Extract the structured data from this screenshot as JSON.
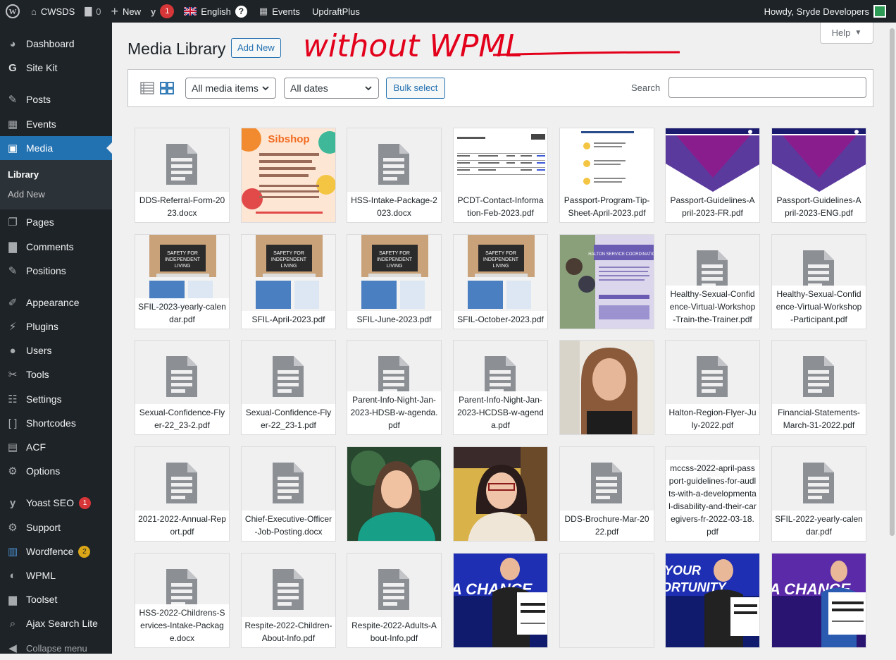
{
  "adminbar": {
    "site_name": "CWSDS",
    "comments_count": "0",
    "new_label": "New",
    "yoast_count": "1",
    "language": "English",
    "events": "Events",
    "updraft": "UpdraftPlus",
    "howdy": "Howdy, Sryde Developers"
  },
  "sidebar": {
    "dashboard": "Dashboard",
    "sitekit": "Site Kit",
    "posts": "Posts",
    "events": "Events",
    "media": "Media",
    "library": "Library",
    "add_new": "Add New",
    "pages": "Pages",
    "comments": "Comments",
    "positions": "Positions",
    "appearance": "Appearance",
    "plugins": "Plugins",
    "users": "Users",
    "tools": "Tools",
    "settings": "Settings",
    "shortcodes": "Shortcodes",
    "acf": "ACF",
    "options": "Options",
    "yoast": "Yoast SEO",
    "yoast_badge": "1",
    "support": "Support",
    "wordfence": "Wordfence",
    "wordfence_badge": "2",
    "wpml": "WPML",
    "toolset": "Toolset",
    "ajax": "Ajax Search Lite",
    "collapse": "Collapse menu"
  },
  "header": {
    "title": "Media Library",
    "add_new": "Add New",
    "help": "Help",
    "annotation": "without WPML"
  },
  "toolbar": {
    "filter_type": "All media items",
    "filter_date": "All dates",
    "bulk_select": "Bulk select",
    "search_label": "Search"
  },
  "media": [
    {
      "name": "DDS-Referral-Form-2023.docx"
    },
    {
      "name": "Sibshop"
    },
    {
      "name": "HSS-Intake-Package-2023.docx"
    },
    {
      "name": "PCDT-Contact-Information-Feb-2023.pdf"
    },
    {
      "name": "Passport-Program-Tip-Sheet-April-2023.pdf"
    },
    {
      "name": "Passport-Guidelines-April-2023-FR.pdf"
    },
    {
      "name": "Passport-Guidelines-April-2023-ENG.pdf"
    },
    {
      "name": "SFIL-2023-yearly-calendar.pdf"
    },
    {
      "name": "SFIL-April-2023.pdf"
    },
    {
      "name": "SFIL-June-2023.pdf"
    },
    {
      "name": "SFIL-October-2023.pdf"
    },
    {
      "name": "Halton Service Coordination"
    },
    {
      "name": "Healthy-Sexual-Confidence-Virtual-Workshop-Train-the-Trainer.pdf"
    },
    {
      "name": "Healthy-Sexual-Confidence-Virtual-Workshop-Participant.pdf"
    },
    {
      "name": "Sexual-Confidence-Flyer-22_23-2.pdf"
    },
    {
      "name": "Sexual-Confidence-Flyer-22_23-1.pdf"
    },
    {
      "name": "Parent-Info-Night-Jan-2023-HDSB-w-agenda.pdf"
    },
    {
      "name": "Parent-Info-Night-Jan-2023-HCDSB-w-agenda.pdf"
    },
    {
      "name": ""
    },
    {
      "name": "Halton-Region-Flyer-July-2022.pdf"
    },
    {
      "name": "Financial-Statements-March-31-2022.pdf"
    },
    {
      "name": "2021-2022-Annual-Report.pdf"
    },
    {
      "name": "Chief-Executive-Officer-Job-Posting.docx"
    },
    {
      "name": ""
    },
    {
      "name": ""
    },
    {
      "name": "DDS-Brochure-Mar-2022.pdf"
    },
    {
      "name": "mccss-2022-april-passport-guidelines-for-audlts-with-a-developmental-disability-and-their-caregivers-fr-2022-03-18.pdf"
    },
    {
      "name": "SFIL-2022-yearly-calendar.pdf"
    },
    {
      "name": "HSS-2022-Childrens-Services-Intake-Package.docx"
    },
    {
      "name": "Respite-2022-Children-About-Info.pdf"
    },
    {
      "name": "Respite-2022-Adults-About-Info.pdf"
    },
    {
      "name": "A CHANCE"
    },
    {
      "name": ""
    },
    {
      "name": "YOUR OPPORTUNITY"
    },
    {
      "name": "A CHANCE"
    }
  ],
  "thumb_text": {
    "sibshop": "Sibshop",
    "sfil": "SAFETY FOR INDEPENDENT LIVING",
    "halton": "HALTON SERVICE COORDINATION",
    "chance": "A CHANCE",
    "opportunity": "YOUR OPPORTUNITY"
  }
}
